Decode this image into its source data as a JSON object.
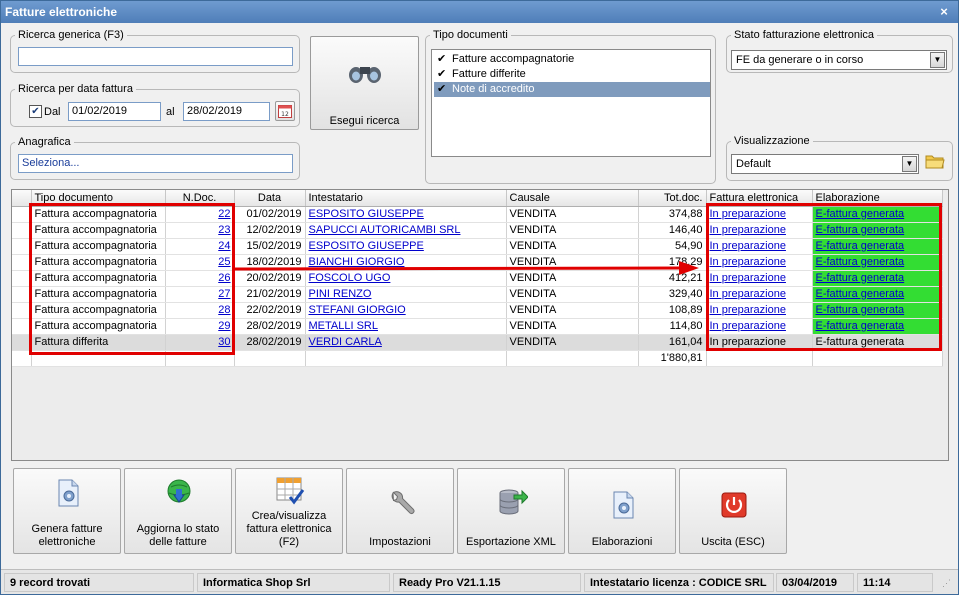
{
  "window": {
    "title": "Fatture elettroniche",
    "close": "×"
  },
  "search": {
    "generic_legend": "Ricerca generica (F3)",
    "generic_value": "",
    "date_legend": "Ricerca per data fattura",
    "dal_label": "Dal",
    "dal_checked": true,
    "date_from": "01/02/2019",
    "al_label": "al",
    "date_to": "28/02/2019",
    "calendar_day": "12",
    "anagrafica_legend": "Anagrafica",
    "anagrafica_value": "Seleziona..."
  },
  "search_button": {
    "label": "Esegui ricerca",
    "icon": "binoculars-icon"
  },
  "doc_types": {
    "legend": "Tipo documenti",
    "items": [
      {
        "label": "Fatture accompagnatorie",
        "checked": true,
        "selected": false
      },
      {
        "label": "Fatture differite",
        "checked": true,
        "selected": false
      },
      {
        "label": "Note di accredito",
        "checked": true,
        "selected": true
      }
    ]
  },
  "status_filter": {
    "legend": "Stato fatturazione elettronica",
    "selected": "FE da generare o in corso"
  },
  "view": {
    "legend": "Visualizzazione",
    "selected": "Default"
  },
  "grid": {
    "columns": [
      "Tipo documento",
      "N.Doc.",
      "Data",
      "Intestatario",
      "Causale",
      "Tot.doc.",
      "Fattura elettronica",
      "Elaborazione"
    ],
    "rows": [
      {
        "tipo": "Fattura accompagnatoria",
        "ndoc": "22",
        "data": "01/02/2019",
        "intestatario": "ESPOSITO GIUSEPPE",
        "causale": "VENDITA",
        "tot": "374,88",
        "fe": "In preparazione",
        "elab": "E-fattura generata",
        "selected": false
      },
      {
        "tipo": "Fattura accompagnatoria",
        "ndoc": "23",
        "data": "12/02/2019",
        "intestatario": "SAPUCCI AUTORICAMBI SRL",
        "causale": "VENDITA",
        "tot": "146,40",
        "fe": "In preparazione",
        "elab": "E-fattura generata",
        "selected": false
      },
      {
        "tipo": "Fattura accompagnatoria",
        "ndoc": "24",
        "data": "15/02/2019",
        "intestatario": "ESPOSITO GIUSEPPE",
        "causale": "VENDITA",
        "tot": "54,90",
        "fe": "In preparazione",
        "elab": "E-fattura generata",
        "selected": false
      },
      {
        "tipo": "Fattura accompagnatoria",
        "ndoc": "25",
        "data": "18/02/2019",
        "intestatario": "BIANCHI GIORGIO",
        "causale": "VENDITA",
        "tot": "178,29",
        "fe": "In preparazione",
        "elab": "E-fattura generata",
        "selected": false
      },
      {
        "tipo": "Fattura accompagnatoria",
        "ndoc": "26",
        "data": "20/02/2019",
        "intestatario": "FOSCOLO UGO",
        "causale": "VENDITA",
        "tot": "412,21",
        "fe": "In preparazione",
        "elab": "E-fattura generata",
        "selected": false
      },
      {
        "tipo": "Fattura accompagnatoria",
        "ndoc": "27",
        "data": "21/02/2019",
        "intestatario": "PINI RENZO",
        "causale": "VENDITA",
        "tot": "329,40",
        "fe": "In preparazione",
        "elab": "E-fattura generata",
        "selected": false
      },
      {
        "tipo": "Fattura accompagnatoria",
        "ndoc": "28",
        "data": "22/02/2019",
        "intestatario": "STEFANI GIORGIO",
        "causale": "VENDITA",
        "tot": "108,89",
        "fe": "In preparazione",
        "elab": "E-fattura generata",
        "selected": false
      },
      {
        "tipo": "Fattura accompagnatoria",
        "ndoc": "29",
        "data": "28/02/2019",
        "intestatario": "METALLI SRL",
        "causale": "VENDITA",
        "tot": "114,80",
        "fe": "In preparazione",
        "elab": "E-fattura generata",
        "selected": false
      },
      {
        "tipo": "Fattura differita",
        "ndoc": "30",
        "data": "28/02/2019",
        "intestatario": "VERDI CARLA",
        "causale": "VENDITA",
        "tot": "161,04",
        "fe": "In preparazione",
        "elab": "E-fattura generata",
        "selected": true
      }
    ],
    "total": "1'880,81"
  },
  "actions": [
    {
      "label": "Genera fatture elettroniche",
      "icon": "document-gear-icon"
    },
    {
      "label": "Aggiorna lo stato delle fatture",
      "icon": "globe-download-icon"
    },
    {
      "label": "Crea/visualizza fattura elettronica (F2)",
      "icon": "grid-check-icon"
    },
    {
      "label": "Impostazioni",
      "icon": "wrench-icon"
    },
    {
      "label": "Esportazione XML",
      "icon": "database-export-icon"
    },
    {
      "label": "Elaborazioni",
      "icon": "document-gear-icon"
    },
    {
      "label": "Uscita (ESC)",
      "icon": "power-exit-icon"
    }
  ],
  "status_bar": {
    "records": "9 record trovati",
    "company": "Informatica Shop Srl",
    "version": "Ready Pro V21.1.15",
    "license": "Intestatario licenza : CODICE SRL",
    "date": "03/04/2019",
    "time": "11:14"
  },
  "colors": {
    "title_bar": "#5b8ac4",
    "highlight": "#e00000",
    "generated": "#33dd33",
    "link": "#0000cc"
  }
}
